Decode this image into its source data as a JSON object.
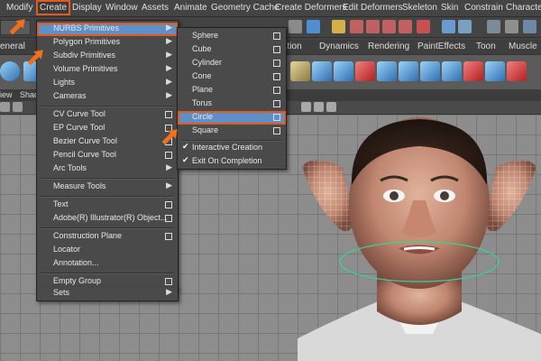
{
  "menubar": {
    "items": [
      "Modify",
      "Create",
      "Display",
      "Window",
      "Assets",
      "Animate",
      "Geometry Cache",
      "Create Deformers",
      "Edit Deformers",
      "Skeleton",
      "Skin",
      "Constrain",
      "Character"
    ],
    "active": "Create",
    "accent_color": "#e35a1c"
  },
  "shelf_tabs": [
    "eneral",
    "ation",
    "Dynamics",
    "Rendering",
    "PaintEffects",
    "Toon",
    "Muscle"
  ],
  "panel_menu": [
    "iew",
    "Shad"
  ],
  "create_menu": {
    "items": [
      {
        "label": "NURBS Primitives",
        "submenu": true,
        "highlighted": true
      },
      {
        "label": "Polygon Primitives",
        "submenu": true
      },
      {
        "label": "Subdiv Primitives",
        "submenu": true
      },
      {
        "label": "Volume Primitives",
        "submenu": true
      },
      {
        "label": "Lights",
        "submenu": true
      },
      {
        "label": "Cameras",
        "submenu": true
      },
      {
        "label": "CV Curve Tool",
        "option": true
      },
      {
        "label": "EP Curve Tool",
        "option": true
      },
      {
        "label": "Bezier Curve Tool",
        "option": true
      },
      {
        "label": "Pencil Curve Tool",
        "option": true
      },
      {
        "label": "Arc Tools",
        "submenu": true
      },
      {
        "label": "Measure Tools",
        "submenu": true
      },
      {
        "label": "Text",
        "option": true
      },
      {
        "label": "Adobe(R) Illustrator(R) Object...",
        "option": true
      },
      {
        "label": "Construction Plane",
        "option": true
      },
      {
        "label": "Locator"
      },
      {
        "label": "Annotation..."
      },
      {
        "label": "Empty Group",
        "option": true
      },
      {
        "label": "Sets",
        "submenu": true
      }
    ]
  },
  "nurbs_menu": {
    "items": [
      {
        "label": "Sphere",
        "option": true
      },
      {
        "label": "Cube",
        "option": true
      },
      {
        "label": "Cylinder",
        "option": true
      },
      {
        "label": "Cone",
        "option": true
      },
      {
        "label": "Plane",
        "option": true
      },
      {
        "label": "Torus",
        "option": true
      },
      {
        "label": "Circle",
        "option": true,
        "highlighted": true
      },
      {
        "label": "Square",
        "option": true
      },
      {
        "label": "Interactive Creation",
        "checked": true
      },
      {
        "label": "Exit On Completion",
        "checked": true
      }
    ],
    "highlight_color": "#5e8fc7"
  }
}
